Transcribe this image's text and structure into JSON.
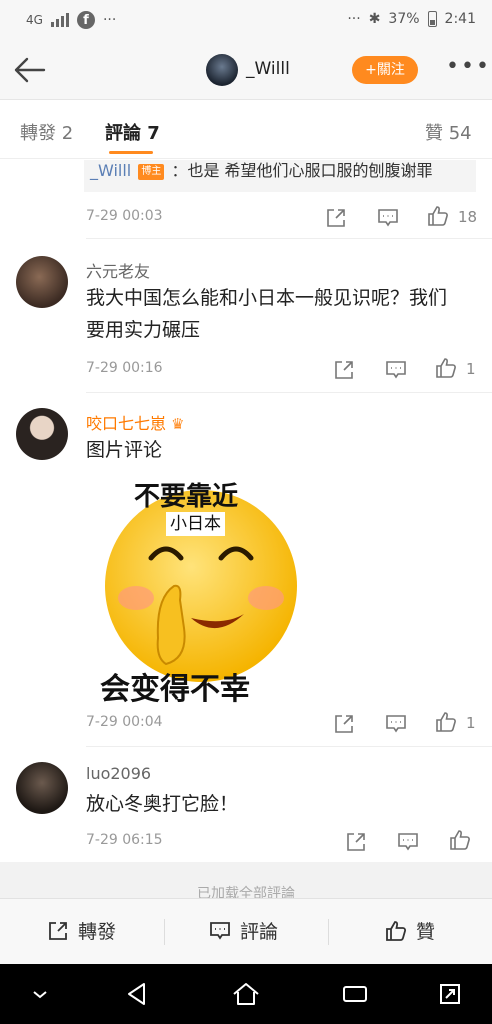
{
  "status_bar": {
    "network": "4G",
    "battery": "37%",
    "time": "2:41",
    "dots": "···"
  },
  "header": {
    "title": "_Willl",
    "follow_label": "+關注",
    "more_label": "•••"
  },
  "tabs": {
    "repost": "轉發 2",
    "comment": "評論 7",
    "like": "贊 54"
  },
  "comments": [
    {
      "reply_user": "_Willl",
      "reply_tag": "博主",
      "reply_text": "：也是 希望他们心服口服的刨腹谢罪",
      "time": "7-29 00:03",
      "likes": "18"
    },
    {
      "user": "六元老友",
      "text_line1": "我大中国怎么能和小日本一般见识呢？我们",
      "text_line2": "要用实力碾压",
      "time": "7-29 00:16",
      "likes": "1"
    },
    {
      "user": "咬口七七崽",
      "text": "图片评论",
      "image_top": "不要靠近",
      "image_tag": "小日本",
      "image_bottom": "会变得不幸",
      "time": "7-29 00:04",
      "likes": "1"
    },
    {
      "user": "luo2096",
      "text": "放心冬奥打它脸！",
      "time": "7-29 06:15",
      "likes": ""
    }
  ],
  "loading_text": "已加载全部評論",
  "bottom_bar": {
    "repost": "轉發",
    "comment": "評論",
    "like": "贊"
  },
  "colors": {
    "accent": "#ff8a1f",
    "username_highlight": "#ff7a00",
    "link_blue": "#5b7fb5"
  }
}
